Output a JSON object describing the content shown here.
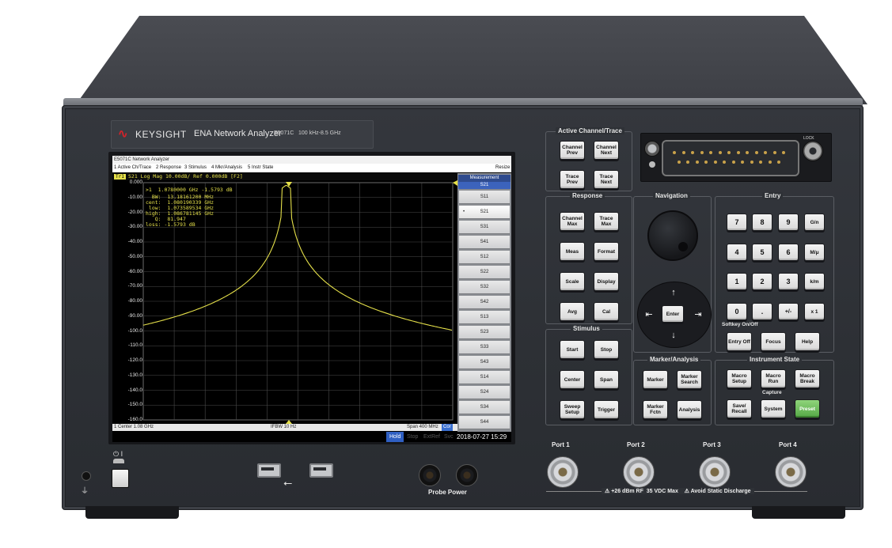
{
  "brand": {
    "company": "KEYSIGHT",
    "product": "ENA Network Analyzer",
    "model": "E5071C",
    "range": "100 kHz-8.5 GHz"
  },
  "screen": {
    "window_title": "E5071C Network Analyzer",
    "menu": [
      "1 Active Ch/Trace",
      "2 Response",
      "3 Stimulus",
      "4 Mkr/Analysis",
      "5 Instr State"
    ],
    "resize": "Resize",
    "trace_box": "Tr1",
    "trace_header": "S21 Log Mag 10.00dB/ Ref 0.000dB [F2]",
    "y_axis": {
      "labels": [
        "0.000",
        "-10.00",
        "-20.00",
        "-30.00",
        "-40.00",
        "-50.00",
        "-60.00",
        "-70.00",
        "-80.00",
        "-90.00",
        "-100.0",
        "-110.0",
        "-120.0",
        "-130.0",
        "-140.0",
        "-150.0",
        "-160.0"
      ]
    },
    "marker_lines": [
      ">1  1.0780000 GHz -1.5793 dB",
      "  BW:  13.18161200 MHz",
      "cent:  1.080190339 GHz",
      " low:  1.073589534 GHz",
      "high:  1.086781145 GHz",
      "   Q:  81.947",
      "loss: -1.5793 dB"
    ],
    "status": {
      "center": "1  Center 1.08 GHz",
      "ifbw": "IFBW 10 Hz",
      "span": "Span 400 MHz",
      "cor": "Cor"
    },
    "bottom": {
      "hold": "Hold",
      "stop": "Stop",
      "extref": "ExtRef",
      "svc": "Svc",
      "datetime": "2018-07-27 15:29"
    },
    "measurement": {
      "header": "Measurement",
      "selected": "S21",
      "items": [
        "S11",
        "S21",
        "S31",
        "S41",
        "S12",
        "S22",
        "S32",
        "S42",
        "S13",
        "S23",
        "S33",
        "S43",
        "S14",
        "S24",
        "S34",
        "S44"
      ],
      "active_index": 1
    }
  },
  "groups": {
    "active_channel": "Active Channel/Trace",
    "response": "Response",
    "stimulus": "Stimulus",
    "navigation": "Navigation",
    "entry": "Entry",
    "marker_analysis": "Marker/Analysis",
    "instrument_state": "Instrument State"
  },
  "keys": {
    "channel_prev": "Channel Prev",
    "channel_next": "Channel Next",
    "trace_prev": "Trace Prev",
    "trace_next": "Trace Next",
    "channel_max": "Channel Max",
    "trace_max": "Trace Max",
    "meas": "Meas",
    "format": "Format",
    "scale": "Scale",
    "display": "Display",
    "avg": "Avg",
    "cal": "Cal",
    "start": "Start",
    "stop": "Stop",
    "center": "Center",
    "span": "Span",
    "sweep_setup": "Sweep Setup",
    "trigger": "Trigger",
    "marker": "Marker",
    "marker_search": "Marker Search",
    "marker_fctn": "Marker Fctn",
    "analysis": "Analysis",
    "enter": "Enter",
    "digits": [
      "7",
      "8",
      "9",
      "4",
      "5",
      "6",
      "1",
      "2",
      "3",
      "0",
      "."
    ],
    "g_n": "G/n",
    "m_u": "M/μ",
    "k_m": "k/m",
    "plus_minus": "+/-",
    "x1": "x 1",
    "softkey_onoff": "Softkey On/Off",
    "entry_off": "Entry Off",
    "focus": "Focus",
    "help": "Help",
    "macro_setup": "Macro Setup",
    "macro_run": "Macro Run",
    "macro_break": "Macro Break",
    "capture": "Capture",
    "save_recall": "Save/ Recall",
    "system": "System",
    "preset": "Preset"
  },
  "front_panel": {
    "lock": "LOCK",
    "probe_power": "Probe Power",
    "ports": [
      "Port 1",
      "Port 2",
      "Port 3",
      "Port 4"
    ],
    "warning": "⚠ +26 dBm RF  35 VDC Max    ⚠ Avoid Static Discharge",
    "power_symbol": "⏻ I"
  },
  "colors": {
    "trace": "#e5e04a",
    "preset": "#6bbf57",
    "logo": "#d2232a",
    "hold": "#2f5fc2"
  }
}
